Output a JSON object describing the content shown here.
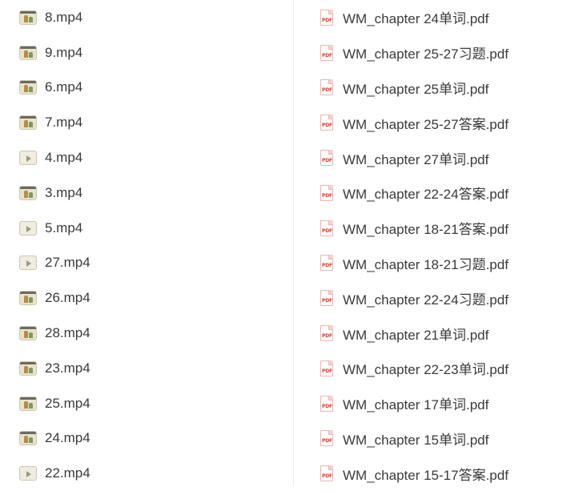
{
  "videos": [
    {
      "name": "8.mp4",
      "thumb": "figures"
    },
    {
      "name": "9.mp4",
      "thumb": "figures"
    },
    {
      "name": "6.mp4",
      "thumb": "figures"
    },
    {
      "name": "7.mp4",
      "thumb": "figures"
    },
    {
      "name": "4.mp4",
      "thumb": "plain"
    },
    {
      "name": "3.mp4",
      "thumb": "figures"
    },
    {
      "name": "5.mp4",
      "thumb": "plain"
    },
    {
      "name": "27.mp4",
      "thumb": "plain"
    },
    {
      "name": "26.mp4",
      "thumb": "figures"
    },
    {
      "name": "28.mp4",
      "thumb": "figures"
    },
    {
      "name": "23.mp4",
      "thumb": "figures"
    },
    {
      "name": "25.mp4",
      "thumb": "figures"
    },
    {
      "name": "24.mp4",
      "thumb": "figures"
    },
    {
      "name": "22.mp4",
      "thumb": "plain"
    }
  ],
  "pdfs": [
    {
      "name": "WM_chapter 24单词.pdf"
    },
    {
      "name": "WM_chapter 25-27习题.pdf"
    },
    {
      "name": "WM_chapter 25单词.pdf"
    },
    {
      "name": "WM_chapter 25-27答案.pdf"
    },
    {
      "name": "WM_chapter 27单词.pdf"
    },
    {
      "name": "WM_chapter 22-24答案.pdf"
    },
    {
      "name": "WM_chapter 18-21答案.pdf"
    },
    {
      "name": "WM_chapter 18-21习题.pdf"
    },
    {
      "name": "WM_chapter 22-24习题.pdf"
    },
    {
      "name": "WM_chapter 21单词.pdf"
    },
    {
      "name": "WM_chapter 22-23单词.pdf"
    },
    {
      "name": "WM_chapter 17单词.pdf"
    },
    {
      "name": "WM_chapter 15单词.pdf"
    },
    {
      "name": "WM_chapter 15-17答案.pdf"
    }
  ],
  "pdf_badge": "PDF",
  "colors": {
    "pdf_red": "#d7402b",
    "text": "#3a3a3a",
    "divider": "#ececec"
  }
}
